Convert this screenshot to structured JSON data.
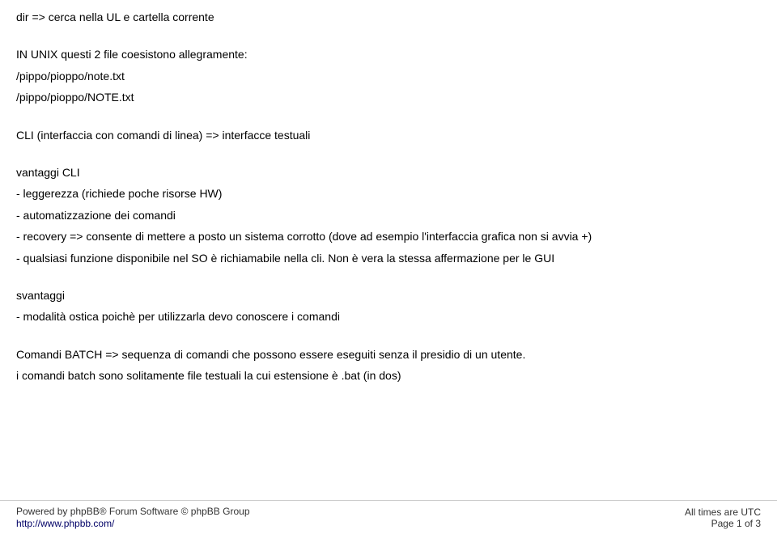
{
  "content": {
    "line1": "dir => cerca nella UL e cartella corrente",
    "spacer1": "",
    "line2": "IN UNIX questi 2 file coesistono allegramente:",
    "line3": "/pippo/pioppo/note.txt",
    "line4": "/pippo/pioppo/NOTE.txt",
    "spacer2": "",
    "line5": "CLI (interfaccia con comandi di linea) => interfacce testuali",
    "spacer3": "",
    "line6": "vantaggi CLI",
    "line7": "- leggerezza (richiede poche risorse HW)",
    "line8": "- automatizzazione dei comandi",
    "line9": "- recovery => consente di mettere a posto un sistema corrotto (dove ad esempio l'interfaccia grafica non si avvia +)",
    "line10": "- qualsiasi funzione disponibile nel SO è richiamabile nella cli. Non è vera la stessa affermazione per le GUI",
    "spacer4": "",
    "line11": "svantaggi",
    "line12": "- modalità ostica poichè per utilizzarla devo conoscere i comandi",
    "spacer5": "",
    "line13": "Comandi BATCH => sequenza di comandi che possono essere eseguiti senza il presidio di un utente.",
    "line14": "i comandi batch sono solitamente file testuali la cui estensione è .bat (in dos)"
  },
  "footer": {
    "powered_by": "Powered by phpBB® Forum Software © phpBB Group",
    "link": "http://www.phpbb.com/",
    "timezone": "All times are UTC",
    "page_info": "Page 1 of 3"
  }
}
